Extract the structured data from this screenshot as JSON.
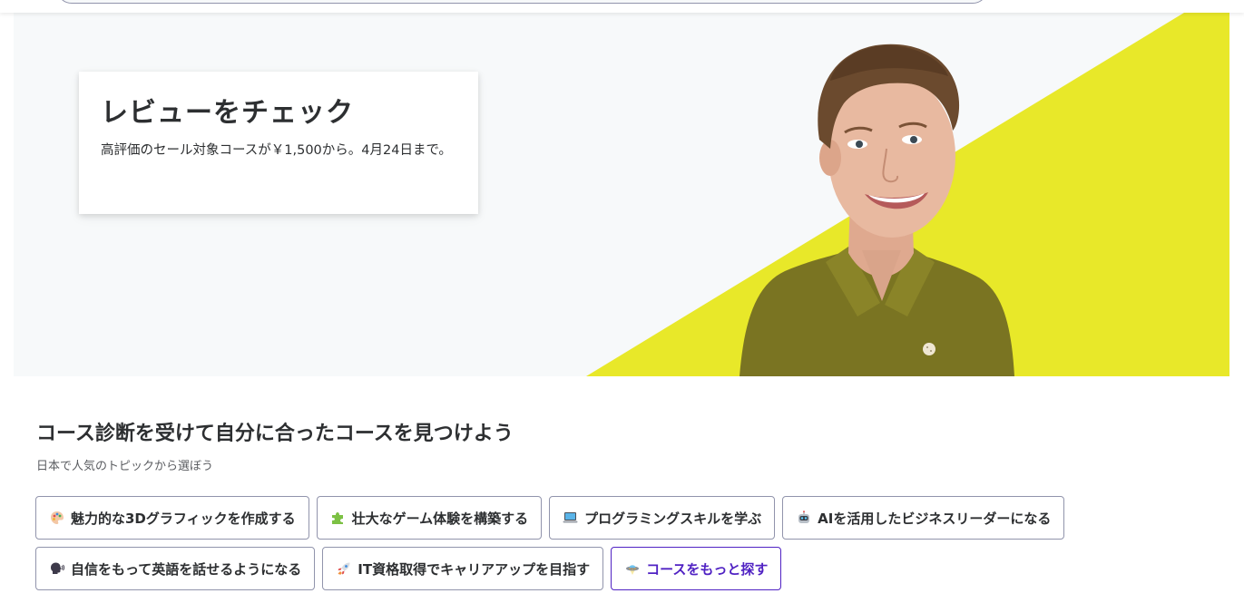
{
  "hero": {
    "title": "レビューをチェック",
    "text": "高評価のセール対象コースが￥1,500から。4月24日まで。",
    "colors": {
      "background": "#f7f9fa",
      "accent": "#e8e829",
      "sweater": "#7a7422",
      "skin": "#e8b9a0",
      "hair": "#6b4a2e"
    }
  },
  "section": {
    "heading": "コース診断を受けて自分に合ったコースを見つけよう",
    "sub": "日本で人気のトピックから選ぼう"
  },
  "chips": [
    {
      "label": "魅力的な3Dグラフィックを作成する",
      "icon": "palette-icon"
    },
    {
      "label": "壮大なゲーム体験を構築する",
      "icon": "puzzle-piece-icon"
    },
    {
      "label": "プログラミングスキルを学ぶ",
      "icon": "laptop-icon"
    },
    {
      "label": "AIを活用したビジネスリーダーになる",
      "icon": "robot-icon"
    },
    {
      "label": "自信をもって英語を話せるようになる",
      "icon": "speaking-head-icon"
    },
    {
      "label": "IT資格取得でキャリアアップを目指す",
      "icon": "rocket-icon"
    },
    {
      "label": "コースをもっと探す",
      "icon": "ufo-icon",
      "accent_color": "#5022c3"
    }
  ]
}
